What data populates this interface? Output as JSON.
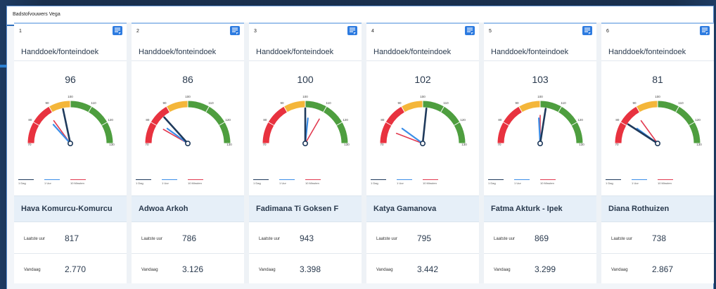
{
  "panel": {
    "title": "Badstofvouwers Vega"
  },
  "gauge_scale": {
    "min": 70,
    "max": 130,
    "ticks": [
      "70",
      "80",
      "90",
      "100",
      "110",
      "120",
      "130"
    ],
    "bands": [
      {
        "from": 70,
        "to": 90,
        "color": "#e8323f"
      },
      {
        "from": 90,
        "to": 100,
        "color": "#f4b63a"
      },
      {
        "from": 100,
        "to": 130,
        "color": "#4e9e3f"
      }
    ]
  },
  "legend": [
    {
      "label": "1 Dag",
      "color": "#1f3a5c"
    },
    {
      "label": "1 Uur",
      "color": "#3b8ee8"
    },
    {
      "label": "10 Minuten",
      "color": "#e23a50"
    }
  ],
  "stat_labels": {
    "last_hour": "Laatste uur",
    "today": "Vandaag"
  },
  "cards": [
    {
      "number": "1",
      "label": "Handdoek/fonteindoek",
      "value": "96",
      "needle_day": 96,
      "needle_hour": 86,
      "needle_10min": 88,
      "name": "Hava Komurcu-Komurcu",
      "last_hour": "817",
      "today": "2.770"
    },
    {
      "number": "2",
      "label": "Handdoek/fonteindoek",
      "value": "86",
      "needle_day": 86,
      "needle_hour": 82,
      "needle_10min": 80,
      "name": "Adwoa Arkoh",
      "last_hour": "786",
      "today": "3.126"
    },
    {
      "number": "3",
      "label": "Handdoek/fonteindoek",
      "value": "100",
      "needle_day": 100,
      "needle_hour": 102,
      "needle_10min": 110,
      "name": "Fadimana Ti Goksen F",
      "last_hour": "943",
      "today": "3.398"
    },
    {
      "number": "4",
      "label": "Handdoek/fonteindoek",
      "value": "102",
      "needle_day": 102,
      "needle_hour": 82,
      "needle_10min": 77,
      "name": "Katya Gamanova",
      "last_hour": "795",
      "today": "3.442"
    },
    {
      "number": "5",
      "label": "Handdoek/fonteindoek",
      "value": "103",
      "needle_day": 103,
      "needle_hour": 99,
      "needle_10min": 100,
      "name": "Fatma Akturk - Ipek",
      "last_hour": "869",
      "today": "3.299"
    },
    {
      "number": "6",
      "label": "Handdoek/fonteindoek",
      "value": "81",
      "needle_day": 81,
      "needle_hour": 82,
      "needle_10min": 88,
      "name": "Diana Rothuizen",
      "last_hour": "738",
      "today": "2.867"
    }
  ]
}
